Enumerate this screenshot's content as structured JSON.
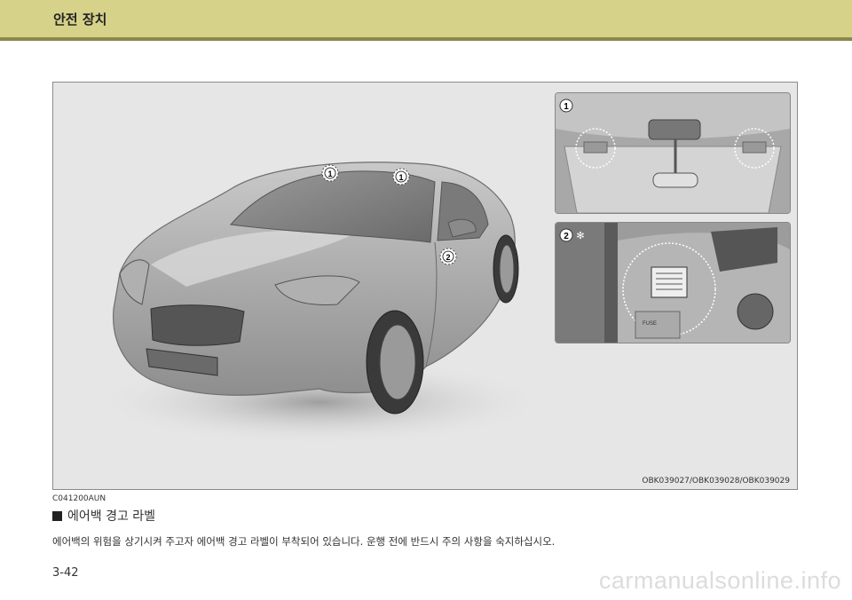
{
  "header": {
    "title": "안전 장치",
    "bg_color": "#d6d28a",
    "line_color": "#8b874a"
  },
  "figure": {
    "code": "OBK039027/OBK039028/OBK039029",
    "markers": {
      "one": "1",
      "two": "2"
    },
    "fuse_label": "FUSE"
  },
  "section": {
    "code": "C041200AUN",
    "title": "에어백 경고 라벨",
    "body": "에어백의 위험을 상기시켜 주고자 에어백 경고 라벨이 부착되어 있습니다. 운행 전에 반드시 주의 사항을 숙지하십시오."
  },
  "page_number": "3-42",
  "watermark": "carmanualsonline.info"
}
